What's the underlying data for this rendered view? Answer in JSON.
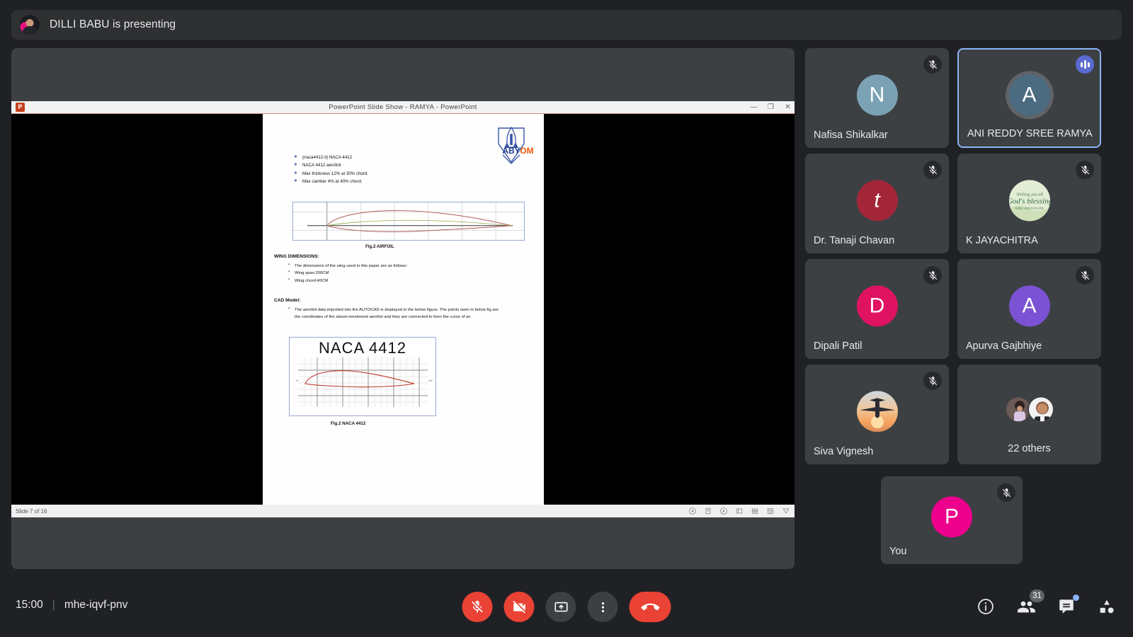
{
  "banner": {
    "presenting_text": "DILLI BABU is presenting",
    "avatar_name": "presenter-avatar"
  },
  "shared_screen": {
    "window_title": "PowerPoint Slide Show  -  RAMYA - PowerPoint",
    "app_badge": "P",
    "window_buttons": [
      "minimize",
      "restore",
      "close"
    ],
    "status_text": "Slide 7 of 16",
    "slide": {
      "logo_text": "ABYOM",
      "diamond_bullets": [
        "(naca4412-il) NACA 4412",
        "NACA 4412 aerofoil",
        "Max thickness 12% at 30% chord.",
        "Max camber 4% at 40% chord."
      ],
      "airfoil_caption": "Fig.2  AIRFOIL",
      "wing_heading": "WING DIMENSIONS:",
      "wing_bullets": [
        "The dimensions of the wing used in this paper are as follows:",
        "Wing span:200CM",
        "Wing chord:40CM"
      ],
      "cad_heading": "CAD Model:",
      "cad_bullets": [
        "The aerofoil data imported into the AUTOCAD is displayed in the below figure. The points seen in below fig are the coordinates of the above-mentioned aerofoil and they are connected to form the curve of an"
      ],
      "naca_title": "NACA 4412",
      "naca_caption": "Fig.2 NACA 4412",
      "naca_axis_left": "0",
      "naca_axis_right": "1,0"
    },
    "show_controls": [
      "previous-slide",
      "pen-tools",
      "next-slide",
      "slide-view",
      "all-slides",
      "zoom-slide",
      "more-options"
    ]
  },
  "participants": [
    {
      "name": "Nafisa Shikalkar",
      "initial": "N",
      "avatar_color": "#7ba2b4",
      "avatar_type": "initial",
      "muted": true,
      "speaking": false
    },
    {
      "name": "ANI REDDY SREE RAMYA",
      "initial": "A",
      "avatar_color": "#4a6b80",
      "avatar_type": "initial",
      "muted": false,
      "speaking": true
    },
    {
      "name": "Dr. Tanaji Chavan",
      "initial": "t",
      "avatar_color": "#a32638",
      "avatar_type": "initial",
      "muted": true,
      "speaking": false
    },
    {
      "name": "K JAYACHITRA",
      "initial": "",
      "avatar_color": "#dfe9cf",
      "avatar_type": "photo-blessing",
      "muted": true,
      "speaking": false
    },
    {
      "name": "Dipali Patil",
      "initial": "D",
      "avatar_color": "#e01362",
      "avatar_type": "initial",
      "muted": true,
      "speaking": false
    },
    {
      "name": "Apurva Gajbhiye",
      "initial": "A",
      "avatar_color": "#7b52d3",
      "avatar_type": "initial",
      "muted": true,
      "speaking": false
    },
    {
      "name": "Siva Vignesh",
      "initial": "",
      "avatar_color": "#f0c08a",
      "avatar_type": "photo-plane",
      "muted": true,
      "speaking": false
    }
  ],
  "others_tile": {
    "label": "22 others"
  },
  "self_tile": {
    "name": "You",
    "initial": "P",
    "avatar_color": "#ec008c",
    "muted": true
  },
  "bottom_bar": {
    "time": "15:00",
    "separator": "|",
    "meeting_code": "mhe-iqvf-pnv",
    "controls": [
      {
        "name": "microphone-off-button",
        "style": "red",
        "icon": "mic-off-icon"
      },
      {
        "name": "camera-off-button",
        "style": "red",
        "icon": "video-off-icon"
      },
      {
        "name": "present-screen-button",
        "style": "grey",
        "icon": "present-icon"
      },
      {
        "name": "more-options-button",
        "style": "grey",
        "icon": "more-vertical-icon"
      },
      {
        "name": "end-call-button",
        "style": "end",
        "icon": "call-end-icon"
      }
    ],
    "right_controls": [
      {
        "name": "meeting-details-button",
        "icon": "info-icon",
        "badge": null,
        "dot": false
      },
      {
        "name": "show-everyone-button",
        "icon": "people-icon",
        "badge": "31",
        "dot": false
      },
      {
        "name": "chat-button",
        "icon": "chat-icon",
        "badge": null,
        "dot": true
      },
      {
        "name": "activities-button",
        "icon": "activities-icon",
        "badge": null,
        "dot": false
      }
    ]
  },
  "colors": {
    "app_background": "#202124",
    "tile_background": "#3c4043",
    "accent_blue": "#8ab4f8",
    "danger_red": "#ea4335",
    "text_primary": "#e8eaed"
  }
}
